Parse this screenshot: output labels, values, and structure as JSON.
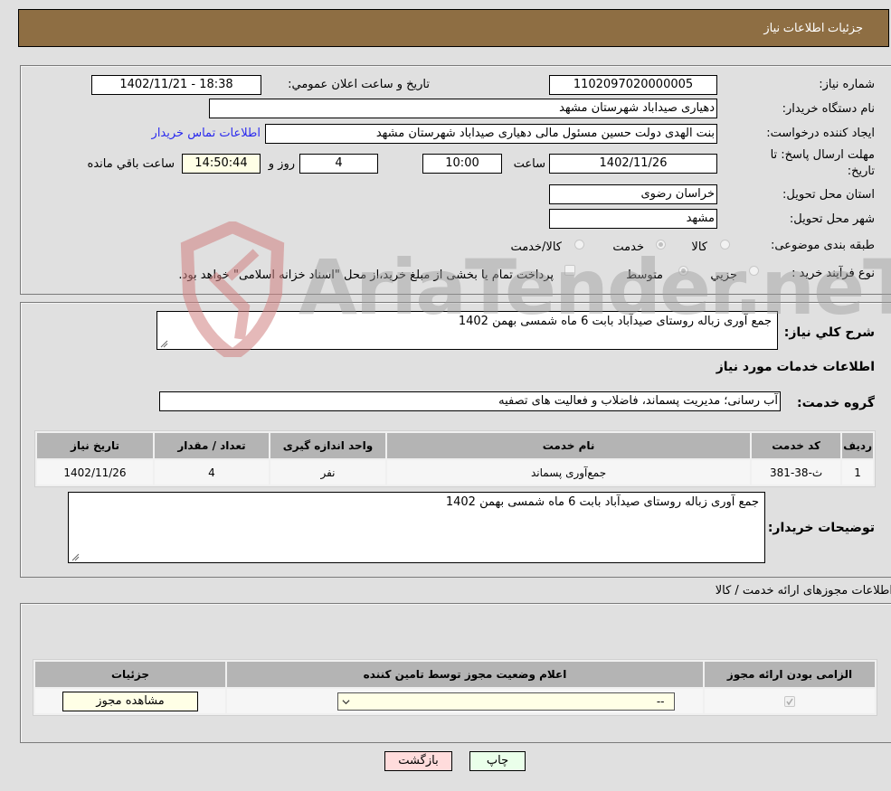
{
  "header": {
    "title": "جزئیات اطلاعات نیاز"
  },
  "details": {
    "need_number_label": "شماره نیاز:",
    "need_number": "1102097020000005",
    "announce_label": "تاریخ و ساعت اعلان عمومي:",
    "announce_value": "1402/11/21 - 18:38",
    "buyer_org_label": "نام دستگاه خریدار:",
    "buyer_org": "دهیاری صیداباد شهرستان مشهد",
    "requester_label": "ایجاد کننده درخواست:",
    "requester": "بنت الهدی دولت حسین مسئول مالی  دهیاری صیداباد شهرستان مشهد",
    "contact_link": "اطلاعات تماس خریدار",
    "deadline_label_line1": "مهلت ارسال پاسخ: تا",
    "deadline_label_line2": "تاریخ:",
    "deadline_date": "1402/11/26",
    "time_label": "ساعت",
    "deadline_time": "10:00",
    "days_value": "4",
    "days_label": "روز و",
    "remaining_time": "14:50:44",
    "remaining_label": "ساعت باقي مانده",
    "province_label": "استان محل تحویل:",
    "province": "خراسان رضوی",
    "city_label": "شهر محل تحویل:",
    "city": "مشهد",
    "category_label": "طبقه بندی موضوعی:",
    "category_options": [
      {
        "label": "کالا",
        "checked": false
      },
      {
        "label": "خدمت",
        "checked": true
      },
      {
        "label": "کالا/خدمت",
        "checked": false
      }
    ],
    "process_label": "نوع فرآیند خرید :",
    "process_options": [
      {
        "label": "جزيي",
        "checked": false
      },
      {
        "label": "متوسط",
        "checked": true
      }
    ],
    "treasury_checkbox_label": "پرداخت تمام یا بخشی از مبلغ خرید،از محل \"اسناد خزانه اسلامی\" خواهد بود.",
    "treasury_checked": false
  },
  "summary": {
    "description_label": "شرح کلي نیاز:",
    "description": "جمع آوری زباله روستای صیدآباد بابت 6 ماه شمسی بهمن 1402",
    "services_heading": "اطلاعات خدمات مورد نیاز",
    "service_group_label": "گروه خدمت:",
    "service_group": "آب رسانی؛ مدیریت پسماند، فاضلاب و فعالیت های تصفیه",
    "table": {
      "headers": [
        "ردیف",
        "کد خدمت",
        "نام خدمت",
        "واحد اندازه گیری",
        "تعداد / مقدار",
        "تاریخ نیاز"
      ],
      "rows": [
        [
          "1",
          "ث-38-381",
          "جمع‌آوری پسماند",
          "نفر",
          "4",
          "1402/11/26"
        ]
      ]
    },
    "buyer_notes_label": "توضیحات خریدار:",
    "buyer_notes": "جمع آوری زباله روستای صیدآباد بابت 6 ماه شمسی بهمن 1402"
  },
  "permits": {
    "heading": "اطلاعات مجوزهای ارائه خدمت / کالا",
    "table": {
      "headers": [
        "الزامی بودن ارائه مجوز",
        "اعلام وضعیت مجوز توسط تامین کننده",
        "جزئیات"
      ],
      "rows": [
        {
          "required_checked": true,
          "status_selected": "--",
          "details_button": "مشاهده مجوز"
        }
      ]
    }
  },
  "footer": {
    "print_button": "چاپ",
    "back_button": "بازگشت"
  },
  "watermark": {
    "text": "AriaTender.neT"
  },
  "colors": {
    "header_bg": "#8e6e43",
    "page_bg": "#e0e0e0",
    "link": "#2a2aee",
    "print_btn_bg": "#eaffea",
    "back_btn_bg": "#ffdcdc",
    "cream": "#ffffe6"
  }
}
